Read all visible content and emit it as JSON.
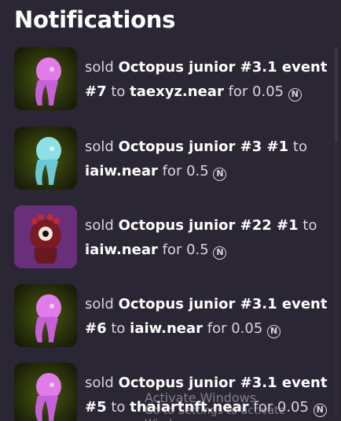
{
  "header": {
    "title": "Notifications"
  },
  "notifications": [
    {
      "action": "sold",
      "item": "Octopus junior #3.1 event #7",
      "to_word": "to",
      "buyer": "taexyz.near",
      "for_word": "for",
      "price": "0.05",
      "thumb": "pink-octopus",
      "currency_icon": "near-icon"
    },
    {
      "action": "sold",
      "item": "Octopus junior #3 #1",
      "to_word": "to",
      "buyer": "iaiw.near",
      "for_word": "for",
      "price": "0.5",
      "thumb": "cyan-octopus",
      "currency_icon": "near-icon"
    },
    {
      "action": "sold",
      "item": "Octopus junior #22 #1",
      "to_word": "to",
      "buyer": "iaiw.near",
      "for_word": "for",
      "price": "0.5",
      "thumb": "red-octopus",
      "currency_icon": "near-icon"
    },
    {
      "action": "sold",
      "item": "Octopus junior #3.1 event #6",
      "to_word": "to",
      "buyer": "iaiw.near",
      "for_word": "for",
      "price": "0.05",
      "thumb": "pink-octopus",
      "currency_icon": "near-icon"
    },
    {
      "action": "sold",
      "item": "Octopus junior #3.1 event #5",
      "to_word": "to",
      "buyer": "thaiartnft.near",
      "for_word": "for",
      "price": "0.05",
      "thumb": "pink-octopus",
      "currency_icon": "near-icon"
    }
  ],
  "watermark": {
    "line1": "Activate Windows",
    "line2": "Go to Settings to activate Windows."
  },
  "colors": {
    "background": "#2a2634",
    "text": "#d8d6dc",
    "strong": "#ffffff"
  }
}
